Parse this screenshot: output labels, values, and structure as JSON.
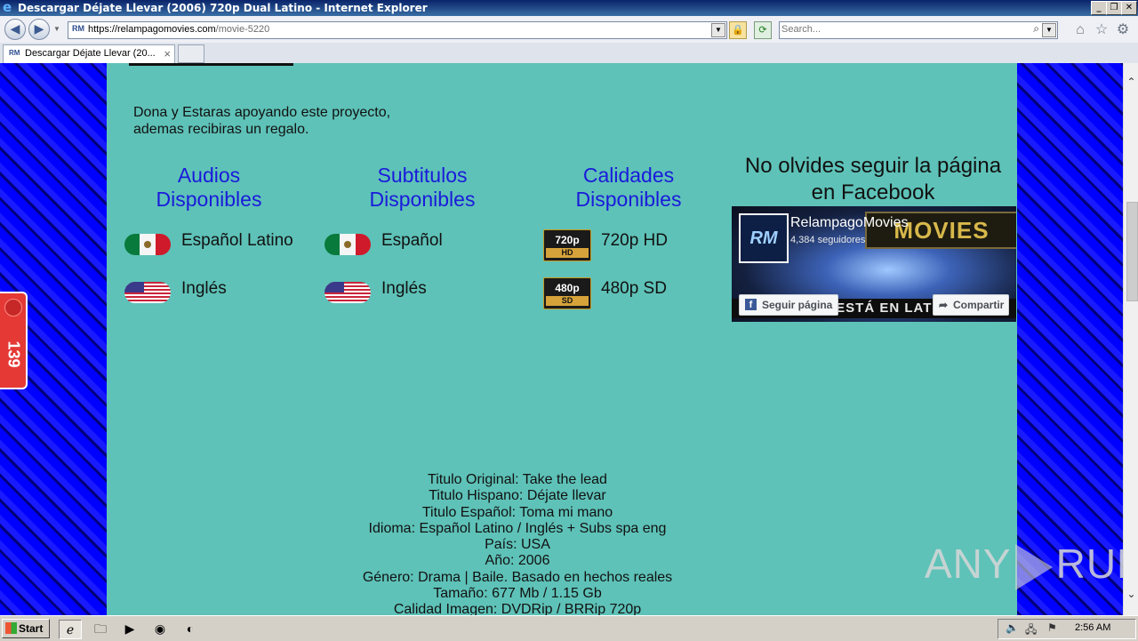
{
  "window": {
    "title": "Descargar Déjate Llevar (2006) 720p Dual Latino - Internet Explorer",
    "minimize": "_",
    "restore": "❐",
    "close": "✕"
  },
  "browser": {
    "url_host": "https://relampagomovies.com",
    "url_path": "/movie-5220",
    "site_icon_text": "RM",
    "search_placeholder": "Search...",
    "tab_label": "Descargar Déjate Llevar (20...",
    "tab_close": "×"
  },
  "page": {
    "donate_line1": "Dona y Estaras apoyando este proyecto,",
    "donate_line2": "ademas recibiras un regalo.",
    "audios": {
      "heading_line1": "Audios",
      "heading_line2": "Disponibles",
      "items": [
        "Español Latino",
        "Inglés"
      ]
    },
    "subtitles": {
      "heading_line1": "Subtitulos",
      "heading_line2": "Disponibles",
      "items": [
        "Español",
        "Inglés"
      ]
    },
    "qualities": {
      "heading_line1": "Calidades",
      "heading_line2": "Disponibles",
      "items": [
        {
          "badge_top": "720p",
          "badge_bottom": "HD",
          "label": "720p HD"
        },
        {
          "badge_top": "480p",
          "badge_bottom": "SD",
          "label": "480p SD"
        }
      ]
    },
    "facebook": {
      "heading_line1": "No olvides seguir la página",
      "heading_line2": "en Facebook",
      "page_name": "RelampagoMovies",
      "followers": "4,384 seguidores",
      "follow_label": "Seguir página",
      "share_label": "Compartir",
      "avatar_text": "RM",
      "banner_text": "MOVIES",
      "band_text": "TODO ESTÁ EN LATINO"
    },
    "movie_info": [
      "Titulo Original: Take the lead",
      "Titulo Hispano: Déjate llevar",
      "Titulo Español: Toma mi mano",
      "Idioma: Español Latino / Inglés + Subs spa eng",
      "País: USA",
      "Año: 2006",
      "Género: Drama | Baile. Basado en hechos reales",
      "Tamaño: 677 Mb / 1.15 Gb",
      "Calidad Imagen: DVDRip / BRRip 720p"
    ],
    "side_badge_count": "139"
  },
  "watermark": {
    "left": "ANY",
    "right": "RUN"
  },
  "taskbar": {
    "start_label": "Start",
    "clock": "2:56 AM"
  },
  "colors": {
    "panel": "#5ec2b8",
    "heading_blue": "#1a1adb",
    "background_blue": "#0000ff"
  }
}
